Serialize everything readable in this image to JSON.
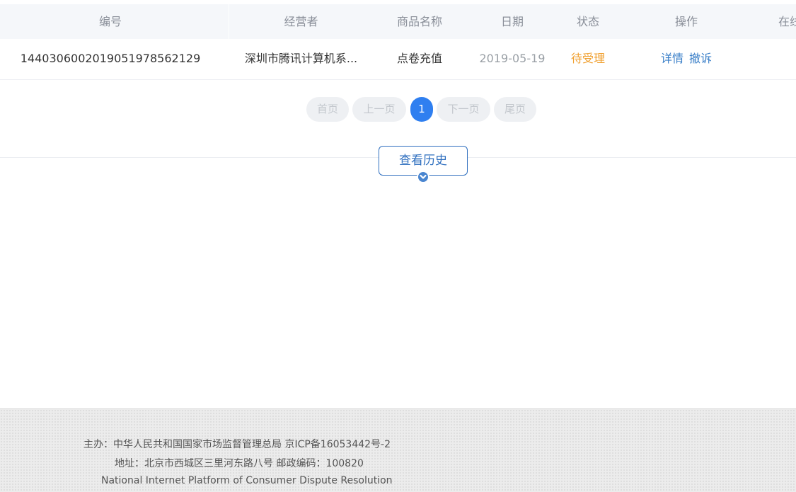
{
  "table": {
    "headers": [
      "编号",
      "经营者",
      "商品名称",
      "日期",
      "状态",
      "操作",
      "在线"
    ],
    "rows": [
      {
        "id": "144030600201905197856​2129",
        "operator": "深圳市腾讯计算机系...",
        "product": "点卷充值",
        "date": "2019-05-19",
        "status": "待受理",
        "actions": [
          "详情",
          "撤诉"
        ]
      }
    ]
  },
  "pagination": {
    "first": "首页",
    "prev": "上一页",
    "current": "1",
    "next": "下一页",
    "last": "尾页"
  },
  "history": {
    "label": "查看历史"
  },
  "footer": {
    "sponsor": "主办：中华人民共和国国家市场监督管理总局 京ICP备16053442号-2",
    "address": "地址：北京市西城区三里河东路八号 邮政编码：100820",
    "english": "National Internet Platform of Consumer Dispute Resolution"
  },
  "colors": {
    "status_pending": "#f0a030",
    "link": "#3a7fc8",
    "accent": "#2f7ff0"
  }
}
